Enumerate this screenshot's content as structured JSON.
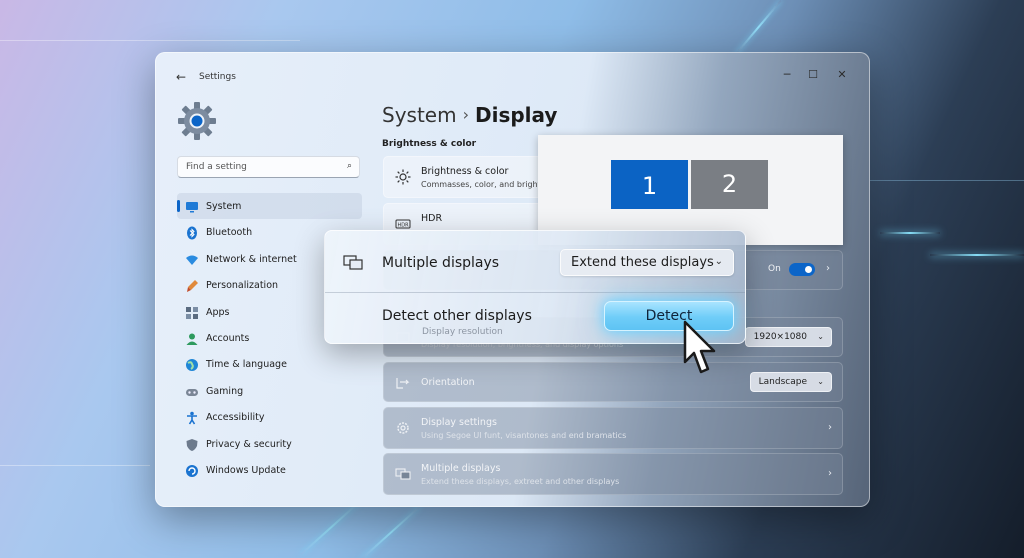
{
  "window": {
    "app_title": "Settings",
    "back_icon": "back-arrow-icon",
    "controls": [
      "minimize",
      "maximize",
      "close"
    ]
  },
  "search": {
    "placeholder": "Find a setting"
  },
  "sidebar": {
    "items": [
      {
        "label": "System",
        "icon": "monitor-icon",
        "active": true
      },
      {
        "label": "Bluetooth",
        "icon": "bluetooth-icon"
      },
      {
        "label": "Network & internet",
        "icon": "wifi-icon"
      },
      {
        "label": "Personalization",
        "icon": "brush-icon"
      },
      {
        "label": "Apps",
        "icon": "apps-icon"
      },
      {
        "label": "Accounts",
        "icon": "person-icon"
      },
      {
        "label": "Time & language",
        "icon": "globe-icon"
      },
      {
        "label": "Gaming",
        "icon": "controller-icon"
      },
      {
        "label": "Accessibility",
        "icon": "accessibility-icon"
      },
      {
        "label": "Privacy & security",
        "icon": "shield-icon"
      },
      {
        "label": "Windows Update",
        "icon": "update-icon"
      }
    ]
  },
  "header": {
    "parent": "System",
    "separator": "›",
    "current": "Display"
  },
  "section": {
    "brightness_color": "Brightness & color"
  },
  "cards": {
    "brightness": {
      "title": "Brightness & color",
      "subtitle": "Commasses, color, and brightne"
    },
    "hdr": {
      "title": "HDR"
    },
    "hdr_toggle_label": "On",
    "resolution": {
      "subtitle": "Display resolution, brightness, and display options",
      "value": "1920×1080"
    },
    "orientation": {
      "title": "Orientation",
      "value": "Landscape"
    },
    "display_settings": {
      "title": "Display settings",
      "subtitle": "Using Segoe UI funt, visantones and end bramatics"
    },
    "multiple_displays": {
      "title": "Multiple displays",
      "subtitle": "Extend these displays, extreet and other displays"
    }
  },
  "preview": {
    "monitors": [
      "1",
      "2"
    ],
    "selected": "1"
  },
  "floating_panel": {
    "multiple_displays_label": "Multiple displays",
    "mode_value": "Extend these displays",
    "detect_label": "Detect other displays",
    "ghost_text": "Display resolution",
    "detect_button": "Detect"
  },
  "colors": {
    "accent": "#0c65c8",
    "glow": "#6fcdf8"
  }
}
